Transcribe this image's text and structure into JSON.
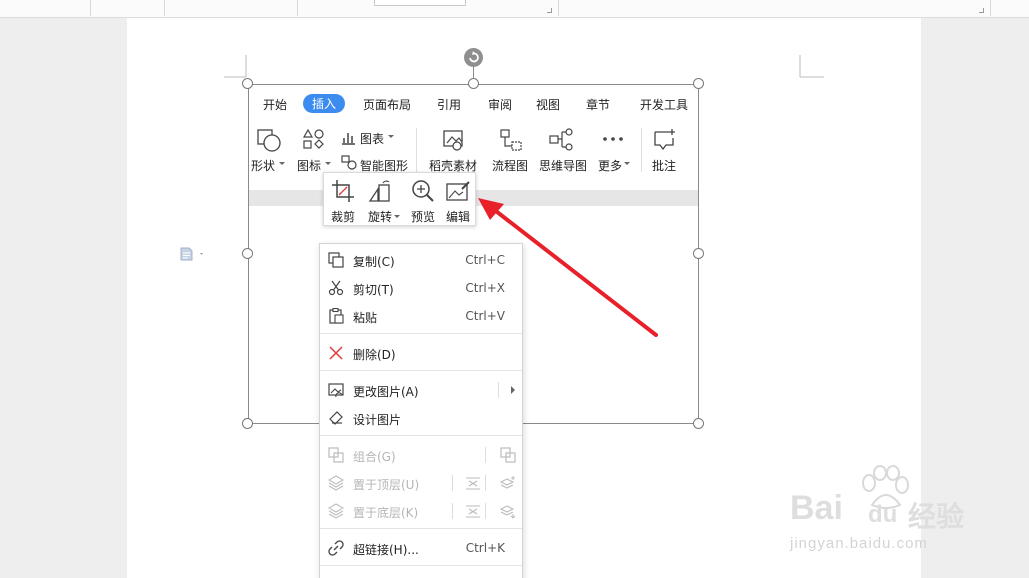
{
  "page_body": {
    "ribbon_tabs": [
      "开始",
      "插入",
      "页面布局",
      "引用",
      "审阅",
      "视图",
      "章节",
      "开发工具"
    ],
    "ribbon_active_tab": "插入",
    "ribbon_items": {
      "shape": "形状",
      "icon": "图标",
      "chart": "图表",
      "smartart": "智能图形",
      "docer_material": "稻壳素材",
      "flowchart": "流程图",
      "mindmap": "思维导图",
      "more": "更多",
      "comment": "批注"
    }
  },
  "mini_toolbar": {
    "crop": "裁剪",
    "rotate": "旋转",
    "preview": "预览",
    "edit": "编辑"
  },
  "context_menu": {
    "items": [
      {
        "label": "复制(C)",
        "shortcut": "Ctrl+C",
        "icon": "copy-icon",
        "enabled": true
      },
      {
        "label": "剪切(T)",
        "shortcut": "Ctrl+X",
        "icon": "cut-icon",
        "enabled": true
      },
      {
        "label": "粘贴",
        "shortcut": "Ctrl+V",
        "icon": "paste-icon",
        "enabled": true
      },
      {
        "label": "删除(D)",
        "shortcut": "",
        "icon": "delete-icon",
        "enabled": true
      },
      {
        "label": "更改图片(A)",
        "shortcut": "",
        "icon": "change-picture-icon",
        "enabled": true,
        "submenu": true
      },
      {
        "label": "设计图片",
        "shortcut": "",
        "icon": "design-picture-icon",
        "enabled": true
      },
      {
        "label": "组合(G)",
        "shortcut": "",
        "icon": "group-icon",
        "enabled": false
      },
      {
        "label": "置于顶层(U)",
        "shortcut": "",
        "icon": "bring-to-front-icon",
        "enabled": false
      },
      {
        "label": "置于底层(K)",
        "shortcut": "",
        "icon": "send-to-back-icon",
        "enabled": false
      },
      {
        "label": "超链接(H)...",
        "shortcut": "Ctrl+K",
        "icon": "hyperlink-icon",
        "enabled": true
      }
    ]
  },
  "watermark": {
    "brand": "Bai",
    "brand2": "du",
    "cn": "经验",
    "url": "jingyan.baidu.com"
  },
  "colors": {
    "accent": "#3c8cf0",
    "arrow": "#e8202a",
    "delete": "#e03c3c"
  }
}
